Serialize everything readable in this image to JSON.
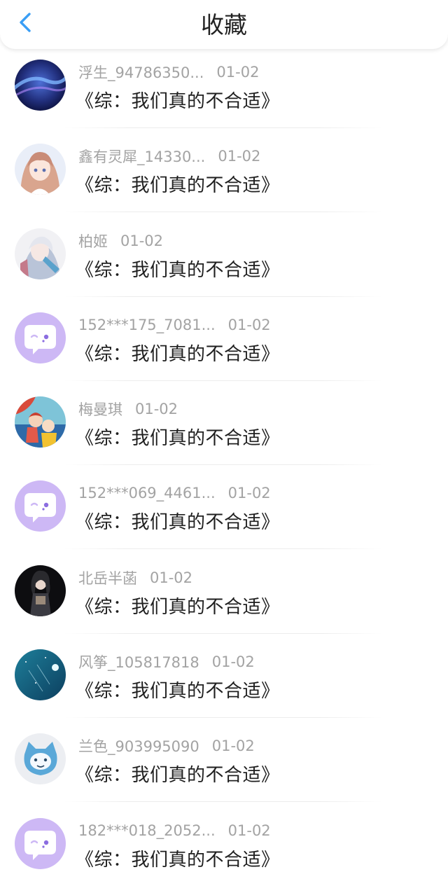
{
  "header": {
    "title": "收藏",
    "back_icon": "chevron-left-icon",
    "accent_color": "#3a9ef5"
  },
  "items": [
    {
      "name": "浮生_94786350...",
      "date": "01-02",
      "title": "《综：我们真的不合适》",
      "avatar": "aurora-night-sky"
    },
    {
      "name": "鑫有灵犀_14330...",
      "date": "01-02",
      "title": "《综：我们真的不合适》",
      "avatar": "anime-girl-pink-hair"
    },
    {
      "name": "柏姬",
      "date": "01-02",
      "title": "《综：我们真的不合适》",
      "avatar": "anime-character-white-blue"
    },
    {
      "name": "152***175_7081...",
      "date": "01-02",
      "title": "《综：我们真的不合适》",
      "avatar": "default-chat-bubble"
    },
    {
      "name": "梅曼琪",
      "date": "01-02",
      "title": "《综：我们真的不合适》",
      "avatar": "ponyo-anime-scene"
    },
    {
      "name": "152***069_4461...",
      "date": "01-02",
      "title": "《综：我们真的不合适》",
      "avatar": "default-chat-bubble"
    },
    {
      "name": "北岳半菡",
      "date": "01-02",
      "title": "《综：我们真的不合适》",
      "avatar": "dark-figure-portrait"
    },
    {
      "name": "风筝_105817818",
      "date": "01-02",
      "title": "《综：我们真的不合适》",
      "avatar": "teal-starry-sky"
    },
    {
      "name": "兰色_903995090",
      "date": "01-02",
      "title": "《综：我们真的不合适》",
      "avatar": "blue-cartoon-cat"
    },
    {
      "name": "182***018_2052...",
      "date": "01-02",
      "title": "《综：我们真的不合适》",
      "avatar": "default-chat-bubble"
    }
  ]
}
